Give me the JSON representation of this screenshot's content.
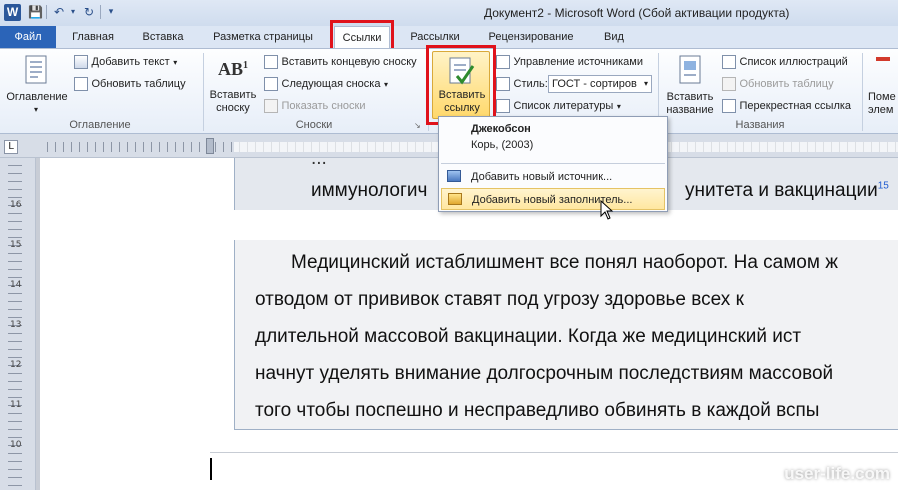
{
  "titlebar": {
    "logo": "W",
    "title": "Документ2  -  Microsoft Word (Сбой активации продукта)"
  },
  "tabs": [
    {
      "label": "Файл"
    },
    {
      "label": "Главная"
    },
    {
      "label": "Вставка"
    },
    {
      "label": "Разметка страницы"
    },
    {
      "label": "Ссылки"
    },
    {
      "label": "Рассылки"
    },
    {
      "label": "Рецензирование"
    },
    {
      "label": "Вид"
    }
  ],
  "ribbon": {
    "toc": {
      "button_label": "Оглавление",
      "add_text": "Добавить текст",
      "update_table": "Обновить таблицу",
      "group_label": "Оглавление"
    },
    "footnotes": {
      "insert_footnote_line1": "Вставить",
      "insert_footnote_line2": "сноску",
      "insert_endnote": "Вставить концевую сноску",
      "next_footnote": "Следующая сноска",
      "show_notes": "Показать сноски",
      "group_label": "Сноски"
    },
    "citations": {
      "insert_citation_line1": "Вставить",
      "insert_citation_line2": "ссылку",
      "manage_sources": "Управление источниками",
      "style_label": "Стиль:",
      "style_value": "ГОСТ - сортиров",
      "bibliography": "Список литературы"
    },
    "captions": {
      "insert_caption_line1": "Вставить",
      "insert_caption_line2": "название",
      "table_of_figures": "Список иллюстраций",
      "update_table": "Обновить таблицу",
      "cross_reference": "Перекрестная ссылка",
      "group_label": "Названия"
    },
    "index": {
      "mark_line1": "Поме",
      "mark_line2": "элем"
    }
  },
  "dropdown": {
    "source_name": "Джекобсон",
    "source_detail": "Корь, (2003)",
    "add_new_source": "Добавить новый источник...",
    "add_new_placeholder": "Добавить новый заполнитель..."
  },
  "document": {
    "partial_line1": "...",
    "partial_line2": "иммунологич",
    "partial_line2_right": "унитета  и  вакцинации",
    "superscript": "15",
    "para_line1": "Медицинский  истаблишмент  все  понял  наоборот.  На  самом  ж",
    "para_line2": "отводом   от   прививок   ставят   под   угрозу   здоровье   всех   к",
    "para_line3": "длительной  массовой  вакцинации.  Когда  же  медицинский  ист",
    "para_line4": "начнут уделять внимание долгосрочным последствиям массовой",
    "para_line5": "того  чтобы  поспешно  и  несправедливо  обвинять  в  каждой  вспы"
  },
  "watermark": "user-life.com",
  "ruler": {
    "v_ticks": [
      "16",
      "15",
      "14",
      "13",
      "12",
      "11",
      "10",
      "9"
    ],
    "corner_tab": "L"
  }
}
